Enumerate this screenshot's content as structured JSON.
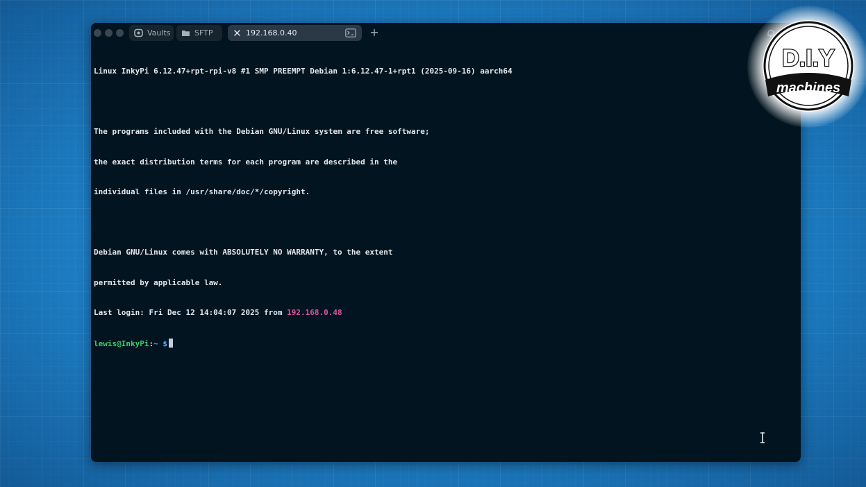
{
  "tabs": [
    {
      "label": "Vaults",
      "icon": "vault-icon"
    },
    {
      "label": "SFTP",
      "icon": "folder-icon"
    },
    {
      "label": "192.168.0.40",
      "icon": "close-icon",
      "active": true
    }
  ],
  "add_tab_symbol": "+",
  "terminal": {
    "banner": "Linux InkyPi 6.12.47+rpt-rpi-v8 #1 SMP PREEMPT Debian 1:6.12.47-1+rpt1 (2025-09-16) aarch64",
    "motd": [
      "The programs included with the Debian GNU/Linux system are free software;",
      "the exact distribution terms for each program are described in the",
      "individual files in /usr/share/doc/*/copyright."
    ],
    "warranty": [
      "Debian GNU/Linux comes with ABSOLUTELY NO WARRANTY, to the extent",
      "permitted by applicable law."
    ],
    "last_login_prefix": "Last login: Fri Dec 12 14:04:07 2025 from ",
    "last_login_ip": "192.168.0.48",
    "prompt_user": "lewis@InkyPi",
    "prompt_sep": ":",
    "prompt_path": "~ $"
  },
  "logo": {
    "line1": "D.I.Y",
    "line2": "machines"
  },
  "colors": {
    "terminal_bg": "#01141f",
    "ip_highlight": "#d8569e",
    "prompt_user": "#35d06a",
    "prompt_path": "#6aa9ff",
    "desktop_bg": "#1d7fc6"
  }
}
